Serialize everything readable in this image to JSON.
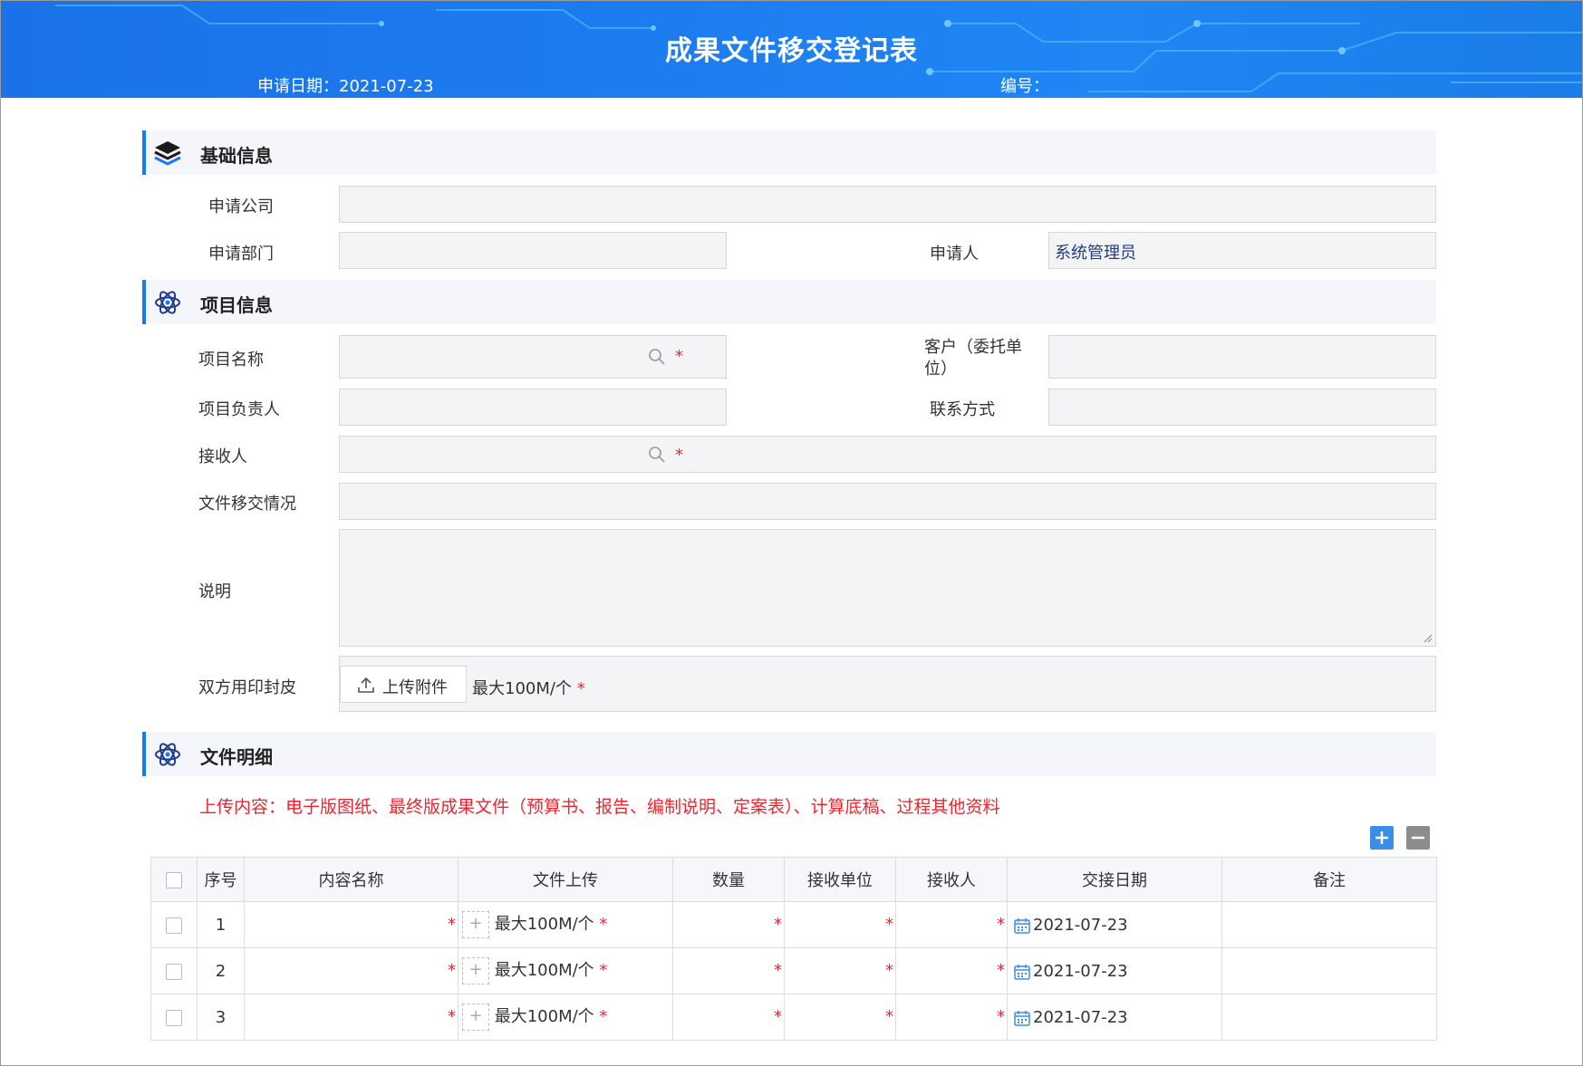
{
  "header": {
    "title": "成果文件移交登记表",
    "date_label": "申请日期：2021-07-23",
    "code_label": "编号："
  },
  "sections": {
    "basic": "基础信息",
    "project": "项目信息",
    "files": "文件明细"
  },
  "basic": {
    "company_label": "申请公司",
    "company_value": "",
    "dept_label": "申请部门",
    "dept_value": "",
    "applicant_label": "申请人",
    "applicant_value": "系统管理员"
  },
  "project": {
    "name_label": "项目名称",
    "client_label_1": "客户（委托单",
    "client_label_2": "位）",
    "owner_label": "项目负责人",
    "contact_label": "联系方式",
    "receiver_label": "接收人",
    "transfer_label": "文件移交情况",
    "desc_label": "说明",
    "seal_label": "双方用印封皮",
    "upload_label": "上传附件",
    "upload_hint": "最大100M/个"
  },
  "required_mark": "*",
  "notice": "上传内容：电子版图纸、最终版成果文件（预算书、报告、编制说明、定案表）、计算底稿、过程其他资料",
  "table": {
    "headers": [
      "序号",
      "内容名称",
      "文件上传",
      "数量",
      "接收单位",
      "接收人",
      "交接日期",
      "备注"
    ],
    "rows": [
      {
        "index": "1",
        "upload_hint": "最大100M/个",
        "date": "2021-07-23"
      },
      {
        "index": "2",
        "upload_hint": "最大100M/个",
        "date": "2021-07-23"
      },
      {
        "index": "3",
        "upload_hint": "最大100M/个",
        "date": "2021-07-23"
      }
    ]
  },
  "colors": {
    "header_blue": "#1d7cf0",
    "accent": "#1677ff",
    "required": "#f5222d",
    "field_bg": "#f4f4f6"
  }
}
